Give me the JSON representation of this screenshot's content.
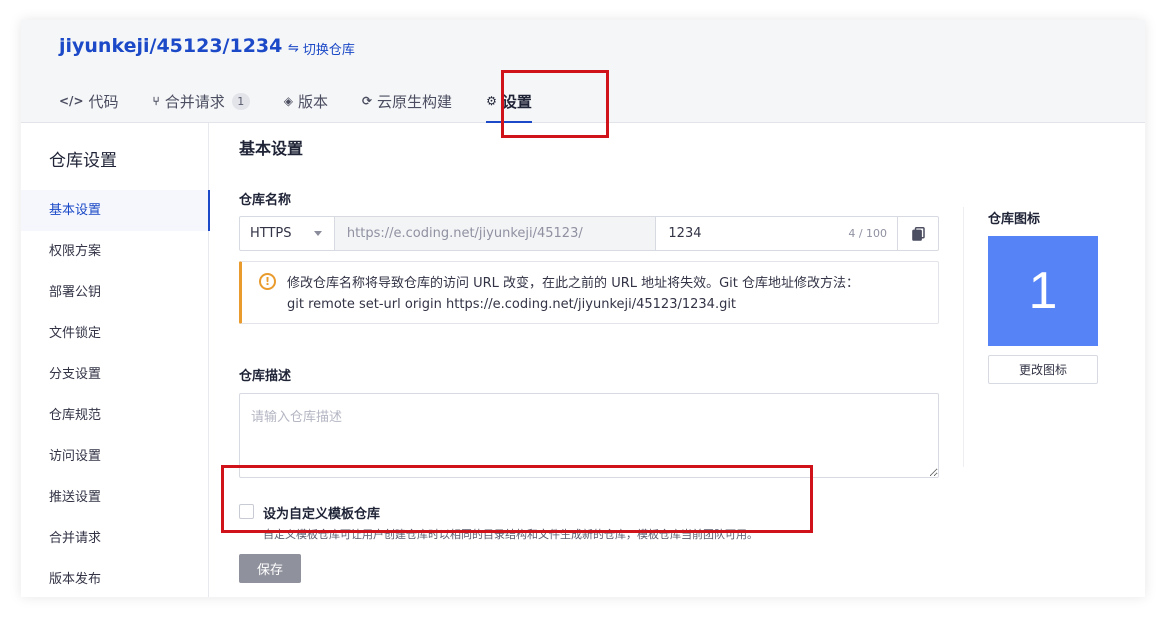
{
  "header": {
    "repo_path": "jiyunkeji/45123/1234",
    "switch_label": "切换仓库",
    "tabs": [
      {
        "label": "代码",
        "icon": "code-icon",
        "glyph": "</>"
      },
      {
        "label": "合并请求",
        "icon": "merge-request-icon",
        "glyph": "⑂",
        "badge": "1"
      },
      {
        "label": "版本",
        "icon": "layers-icon",
        "glyph": "◈"
      },
      {
        "label": "云原生构建",
        "icon": "cloud-build-icon",
        "glyph": "⟳"
      },
      {
        "label": "设置",
        "icon": "gear-icon",
        "glyph": "⚙",
        "active": true
      }
    ]
  },
  "sidebar": {
    "title": "仓库设置",
    "items": [
      {
        "label": "基本设置",
        "active": true
      },
      {
        "label": "权限方案"
      },
      {
        "label": "部署公钥"
      },
      {
        "label": "文件锁定"
      },
      {
        "label": "分支设置"
      },
      {
        "label": "仓库规范"
      },
      {
        "label": "访问设置"
      },
      {
        "label": "推送设置"
      },
      {
        "label": "合并请求"
      },
      {
        "label": "版本发布"
      }
    ]
  },
  "main": {
    "section_title": "基本设置",
    "repo_name": {
      "label": "仓库名称",
      "protocol": "HTTPS",
      "url_prefix": "https://e.coding.net/jiyunkeji/45123/",
      "value": "1234",
      "counter": "4 / 100"
    },
    "warning": {
      "line1": "修改仓库名称将导致仓库的访问 URL 改变，在此之前的 URL 地址将失效。Git 仓库地址修改方法：",
      "line2": "git remote set-url origin https://e.coding.net/jiyunkeji/45123/1234.git"
    },
    "description": {
      "label": "仓库描述",
      "placeholder": "请输入仓库描述"
    },
    "template": {
      "label": "设为自定义模板仓库",
      "hint": "自定义模板仓库可让用户创建仓库时以相同的目录结构和文件生成新的仓库，模板仓库当前团队可用。",
      "checked": false
    },
    "save_label": "保存",
    "repo_icon": {
      "label": "仓库图标",
      "text": "1",
      "color": "#5683f6",
      "change_label": "更改图标"
    }
  },
  "colors": {
    "accent": "#1b49c7",
    "warning": "#ea9b2d",
    "highlight": "#d0121b"
  }
}
